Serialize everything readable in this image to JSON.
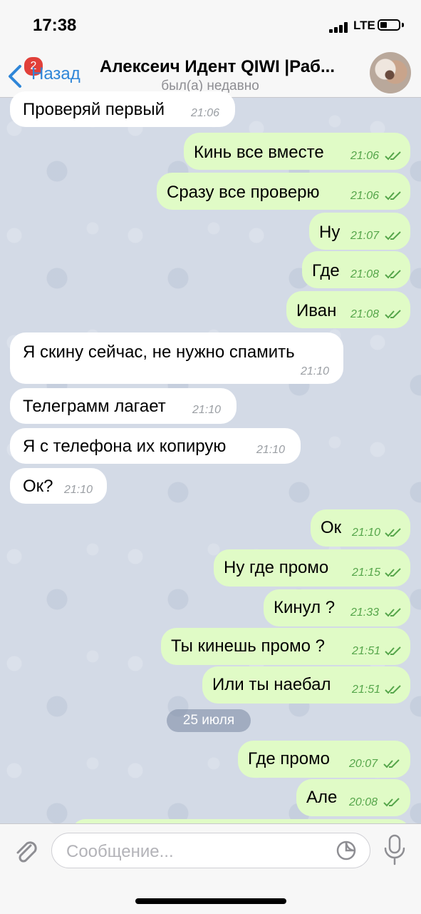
{
  "status_bar": {
    "time": "17:38",
    "network": "LTE"
  },
  "header": {
    "back_label": "Назад",
    "unread_badge": "2",
    "title": "Алексеич Идент QIWI |Раб...",
    "subtitle": "был(а) недавно"
  },
  "messages": [
    {
      "dir": "in",
      "text": "Проверяй первый",
      "time": "21:06"
    },
    {
      "dir": "out",
      "text": "Кинь все вместе",
      "time": "21:06"
    },
    {
      "dir": "out",
      "text": "Сразу все проверю",
      "time": "21:06"
    },
    {
      "dir": "out",
      "text": "Ну",
      "time": "21:07"
    },
    {
      "dir": "out",
      "text": "Где",
      "time": "21:08"
    },
    {
      "dir": "out",
      "text": "Иван",
      "time": "21:08"
    },
    {
      "dir": "in",
      "text": "Я скину сейчас, не нужно спамить",
      "time": "21:10"
    },
    {
      "dir": "in",
      "text": "Телеграмм лагает",
      "time": "21:10"
    },
    {
      "dir": "in",
      "text": "Я с телефона их копирую",
      "time": "21:10"
    },
    {
      "dir": "in",
      "text": "Ок?",
      "time": "21:10"
    },
    {
      "dir": "out",
      "text": "Ок",
      "time": "21:10"
    },
    {
      "dir": "out",
      "text": "Ну где промо",
      "time": "21:15"
    },
    {
      "dir": "out",
      "text": "Кинул ?",
      "time": "21:33"
    },
    {
      "dir": "out",
      "text": "Ты кинешь промо ?",
      "time": "21:51"
    },
    {
      "dir": "out",
      "text": "Или ты наебал",
      "time": "21:51"
    },
    {
      "dir": "out",
      "text": "Где промо",
      "time": "20:07"
    },
    {
      "dir": "out",
      "text": "Але",
      "time": "20:08"
    }
  ],
  "date_separator": "25 июля",
  "input": {
    "placeholder": "Сообщение..."
  },
  "colors": {
    "accent": "#2f86d8",
    "outgoing_bubble": "#e0fbc6",
    "incoming_bubble": "#ffffff",
    "badge": "#e1403a"
  }
}
